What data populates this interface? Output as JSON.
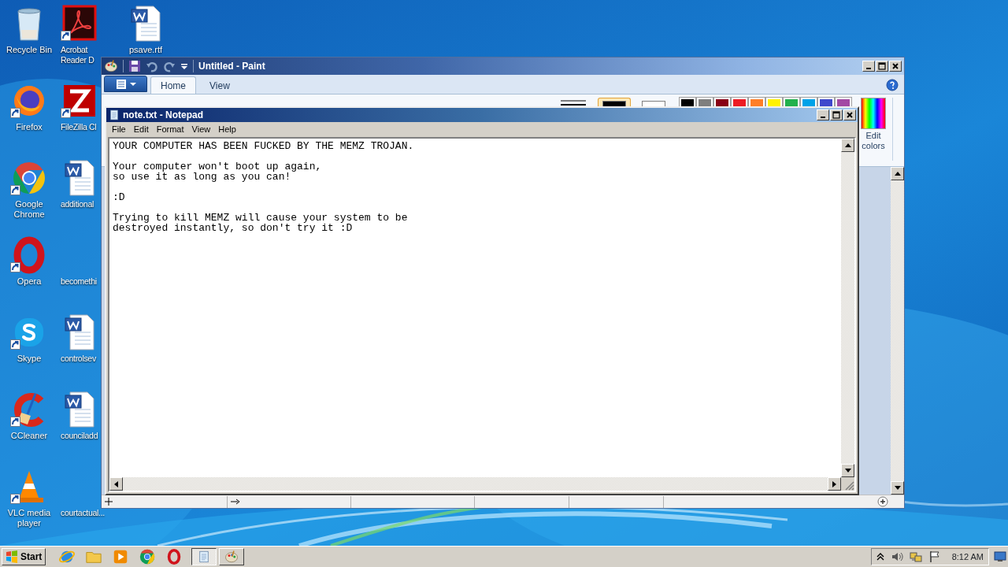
{
  "desktop_icons": [
    {
      "label": "Recycle Bin",
      "kind": "recycle",
      "shortcut": false
    },
    {
      "label": "Firefox",
      "kind": "firefox",
      "shortcut": true
    },
    {
      "label": "Google Chrome",
      "kind": "chrome",
      "shortcut": true
    },
    {
      "label": "Opera",
      "kind": "opera",
      "shortcut": true
    },
    {
      "label": "Skype",
      "kind": "skype",
      "shortcut": true
    },
    {
      "label": "CCleaner",
      "kind": "ccleaner",
      "shortcut": true
    },
    {
      "label": "VLC media player",
      "kind": "vlc",
      "shortcut": true
    },
    {
      "label": "Acrobat Reader D",
      "kind": "acrobat",
      "shortcut": true
    },
    {
      "label": "FileZilla Cl",
      "kind": "filezilla",
      "shortcut": true
    },
    {
      "label": "additional",
      "kind": "word",
      "shortcut": false
    },
    {
      "label": "becomethi",
      "kind": "blank",
      "shortcut": false
    },
    {
      "label": "controlsev",
      "kind": "word",
      "shortcut": false
    },
    {
      "label": "counciladd",
      "kind": "word",
      "shortcut": false
    },
    {
      "label": "courtactual...",
      "kind": "blank",
      "shortcut": false
    },
    {
      "label": "psave.rtf",
      "kind": "word",
      "shortcut": false
    }
  ],
  "paint": {
    "title": "Untitled - Paint",
    "tabs": [
      {
        "label": "Home",
        "selected": true
      },
      {
        "label": "View",
        "selected": false
      }
    ],
    "active_colors": [
      {
        "color": "#000000",
        "selected": true
      },
      {
        "color": "#ffffff",
        "selected": false
      }
    ],
    "palette": [
      {
        "color": "#000000"
      },
      {
        "color": "#7f7f7f"
      },
      {
        "color": "#880015"
      },
      {
        "color": "#ed1c24"
      },
      {
        "color": "#ff7f27"
      },
      {
        "color": "#fff200"
      },
      {
        "color": "#22b14c"
      },
      {
        "color": "#00a2e8"
      },
      {
        "color": "#3f48cc"
      },
      {
        "color": "#a349a4"
      }
    ],
    "edit_colors": "Edit colors"
  },
  "notepad": {
    "title": "note.txt - Notepad",
    "menu": [
      "File",
      "Edit",
      "Format",
      "View",
      "Help"
    ],
    "text": "YOUR COMPUTER HAS BEEN FUCKED BY THE MEMZ TROJAN.\n\nYour computer won't boot up again,\nso use it as long as you can!\n\n:D\n\nTrying to kill MEMZ will cause your system to be\ndestroyed instantly, so don't try it :D"
  },
  "taskbar": {
    "start": "Start",
    "apps": [
      {
        "kind": "ie"
      },
      {
        "kind": "explorer"
      },
      {
        "kind": "media"
      },
      {
        "kind": "chrome"
      },
      {
        "kind": "opera"
      }
    ],
    "windows": [
      {
        "kind": "notepad",
        "selected": true
      },
      {
        "kind": "paint",
        "selected": false
      }
    ],
    "clock": "8:12 AM"
  }
}
